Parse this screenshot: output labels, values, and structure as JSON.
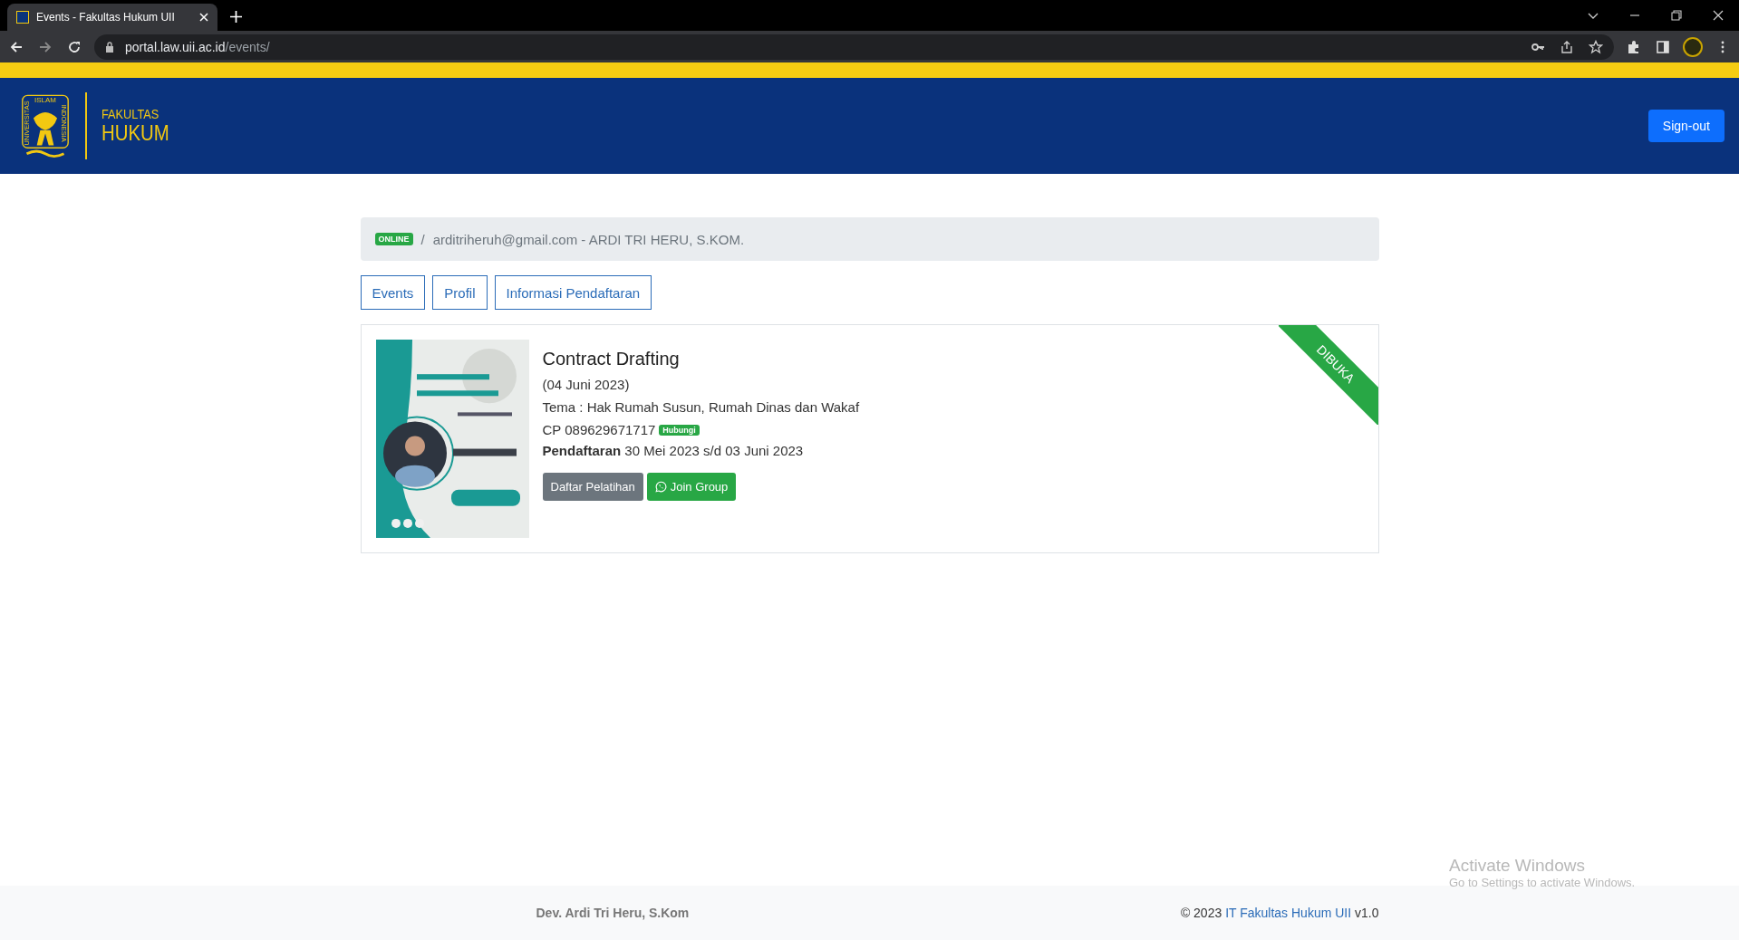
{
  "browser": {
    "tab_title": "Events - Fakultas Hukum UII",
    "url_host": "portal.law.uii.ac.id",
    "url_path": "/events/"
  },
  "header": {
    "logo_texts": [
      "ISLAM",
      "UNIVERSITAS",
      "INDONESIA"
    ],
    "faculty_line1": "FAKULTAS",
    "faculty_line2": "HUKUM",
    "signout": "Sign-out"
  },
  "breadcrumb": {
    "badge": "ONLINE",
    "separator": "/",
    "user": "arditriheruh@gmail.com - ARDI TRI HERU, S.KOM."
  },
  "tabs": [
    {
      "label": "Events"
    },
    {
      "label": "Profil"
    },
    {
      "label": "Informasi Pendaftaran"
    }
  ],
  "events": [
    {
      "title": "Contract Drafting",
      "date": "(04 Juni 2023)",
      "theme": "Tema : Hak Rumah Susun, Rumah Dinas dan Wakaf",
      "contact": "CP 089629671717",
      "contact_badge": "Hubungi",
      "registration_label": "Pendaftaran",
      "registration_dates": "30 Mei 2023 s/d 03 Juni 2023",
      "register_button": "Daftar Pelatihan",
      "group_button": "Join Group",
      "ribbon": "DIBUKA"
    }
  ],
  "footer": {
    "developer": "Dev. Ardi Tri Heru, S.Kom",
    "copyright": "© 2023",
    "link": "IT Fakultas Hukum UII",
    "version": "v1.0"
  },
  "os_notice": {
    "title": "Activate Windows",
    "subtitle": "Go to Settings to activate Windows."
  }
}
